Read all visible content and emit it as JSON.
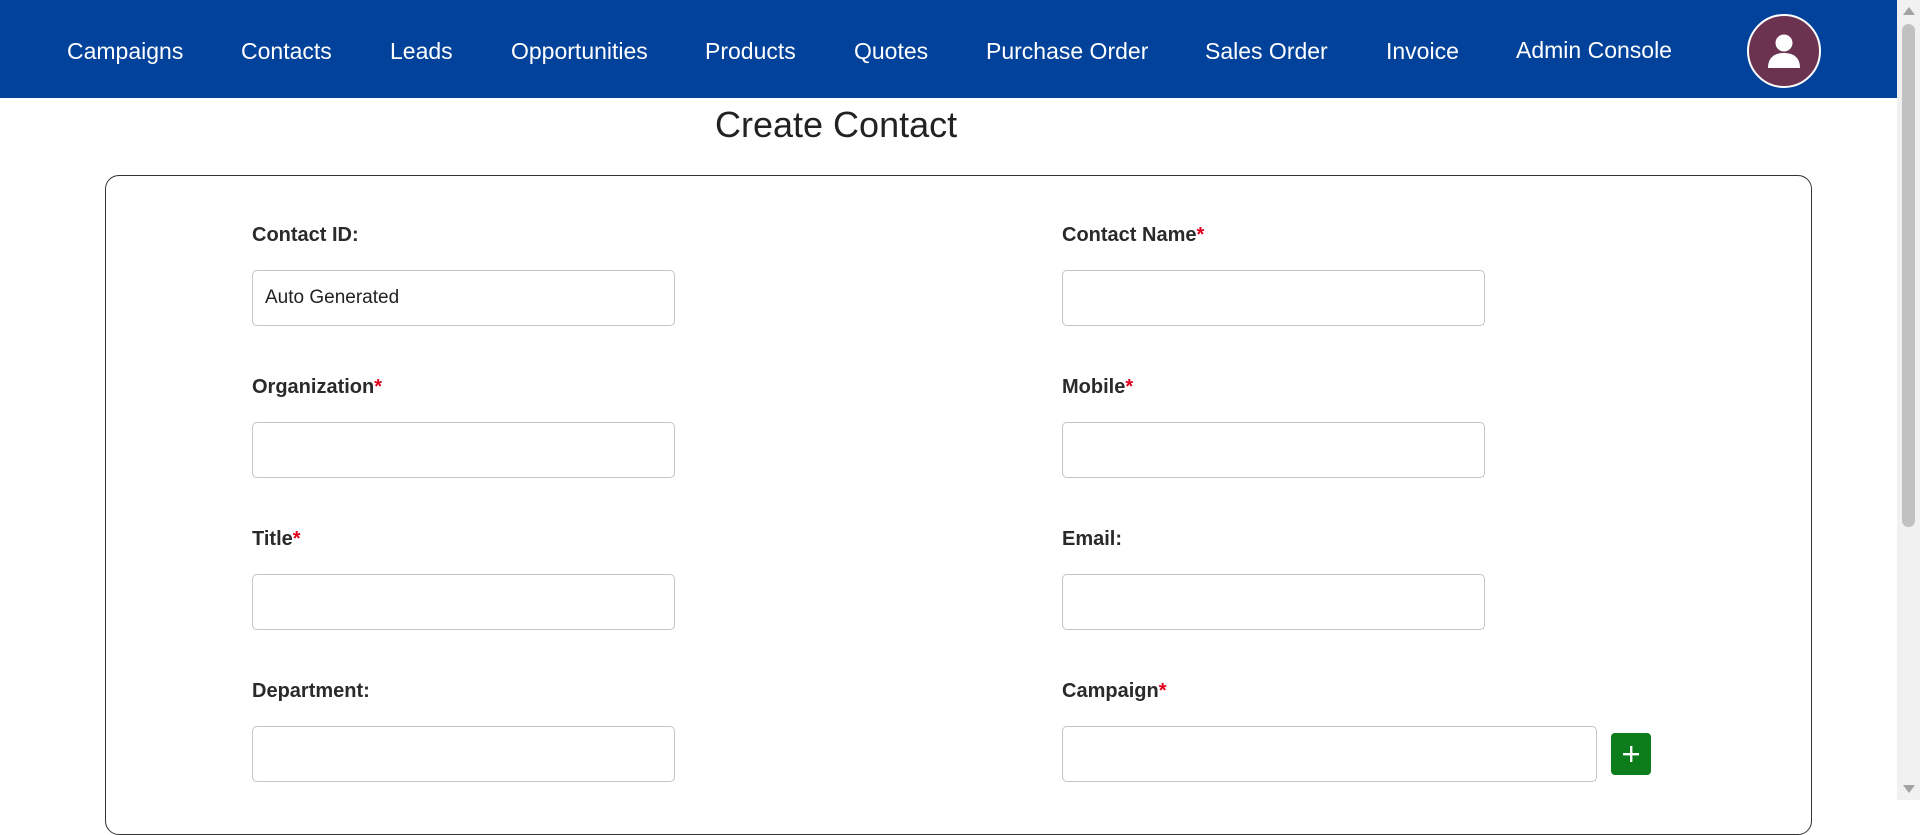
{
  "nav": {
    "items": [
      {
        "label": "Campaigns"
      },
      {
        "label": "Contacts"
      },
      {
        "label": "Leads"
      },
      {
        "label": "Opportunities"
      },
      {
        "label": "Products"
      },
      {
        "label": "Quotes"
      },
      {
        "label": "Purchase Order"
      },
      {
        "label": "Sales Order"
      },
      {
        "label": "Invoice"
      },
      {
        "label": "Admin Console"
      }
    ],
    "avatar_icon": "user-icon"
  },
  "page": {
    "title": "Create Contact"
  },
  "form": {
    "contact_id": {
      "label": "Contact ID:",
      "value": "Auto Generated"
    },
    "contact_name": {
      "label": "Contact Name",
      "required_mark": "*",
      "value": ""
    },
    "organization": {
      "label": "Organization",
      "required_mark": "*",
      "value": ""
    },
    "mobile": {
      "label": "Mobile",
      "required_mark": "*",
      "value": ""
    },
    "title": {
      "label": "Title",
      "required_mark": "*",
      "value": ""
    },
    "email": {
      "label": "Email:",
      "value": ""
    },
    "department": {
      "label": "Department:",
      "value": ""
    },
    "campaign": {
      "label": "Campaign",
      "required_mark": "*",
      "value": "",
      "add_icon": "plus-icon"
    }
  },
  "colors": {
    "navbar": "#03429a",
    "avatar": "#6b3350",
    "required": "#e0001b",
    "add_button": "#0d7d1c"
  }
}
